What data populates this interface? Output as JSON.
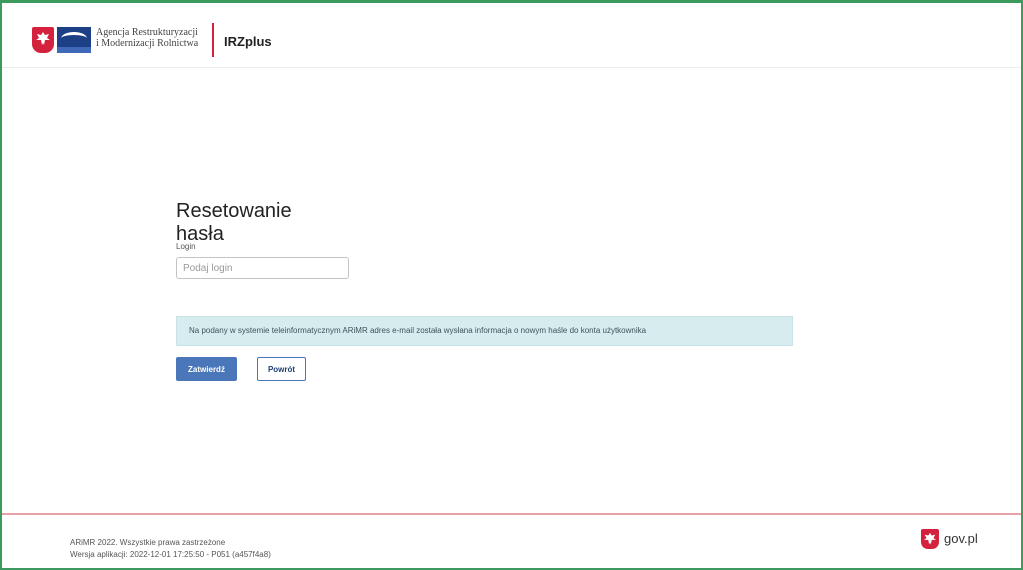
{
  "header": {
    "agency_line1": "Agencja Restrukturyzacji",
    "agency_line2": "i Modernizacji Rolnictwa",
    "app_name": "IRZplus"
  },
  "main": {
    "title": "Resetowanie hasła",
    "login_label": "Login",
    "login_placeholder": "Podaj login",
    "login_value": "",
    "alert_text": "Na podany w systemie teleinformatycznym ARiMR adres e-mail została wysłana informacja o nowym haśle do konta użytkownika",
    "submit_label": "Zatwierdź",
    "back_label": "Powrót"
  },
  "footer": {
    "copyright": "ARiMR 2022. Wszystkie prawa zastrzeżone",
    "version": "Wersja aplikacji: 2022-12-01 17:25:50 - P051 (a457f4a8)",
    "gov_label": "gov.pl"
  },
  "colors": {
    "primary": "#4a77b9",
    "emblem_red": "#d4213d",
    "alert_bg": "#d6ecef",
    "footer_border": "#e8a1a9"
  },
  "icons": {
    "emblem": "polish-eagle-icon",
    "agency_logo": "arimr-logo",
    "gov_emblem": "gov-pl-eagle-icon"
  }
}
